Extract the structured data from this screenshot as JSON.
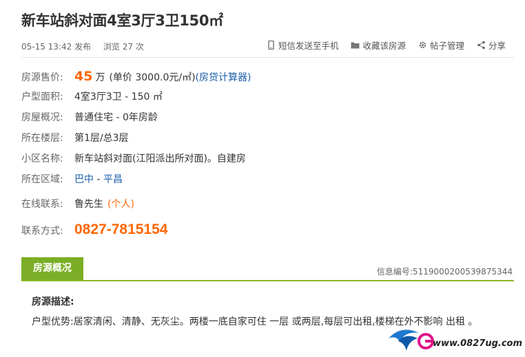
{
  "header": {
    "title": "新车站斜对面4室3厅3卫150㎡",
    "post_time": "05-15 13:42 发布",
    "views": "浏览 27 次"
  },
  "actions": [
    {
      "label": "短信发送至手机",
      "icon": "phone-icon"
    },
    {
      "label": "收藏该房源",
      "icon": "folder-icon"
    },
    {
      "label": "帖子管理",
      "icon": "gear-icon"
    },
    {
      "label": "分享",
      "icon": "share-icon"
    }
  ],
  "details": {
    "price_label": "房源售价:",
    "price_value": "45",
    "price_unit": "万",
    "unit_price": "(单价 3000.0元/㎡)",
    "calculator_link": "(房贷计算器)",
    "layout_label": "户型面积:",
    "layout_value": "4室3厅3卫 - 150 ㎡",
    "overview_label": "房屋概况:",
    "overview_value": "普通住宅 - 0年房龄",
    "floor_label": "所在楼层:",
    "floor_value": "第1层/总3层",
    "community_label": "小区名称:",
    "community_value": "新车站斜对面(江阳派出所对面)。自建房",
    "area_label": "所在区域:",
    "area_city": "巴中",
    "area_separator": " - ",
    "area_district": "平昌",
    "contact_label": "在线联系:",
    "contact_name": "鲁先生",
    "contact_type": "(个人)",
    "phone_label": "联系方式:",
    "phone_value": "0827-7815154"
  },
  "section": {
    "tab_label": "房源概况",
    "info_no": "信息编号:5119000200539875344",
    "desc_title": "房源描述:",
    "desc_text": "户型优势:居家清闲、清静、无灰尘。两楼一底自家可住 一层 或两层,每层可出租,楼梯在外不影响 出租 。"
  },
  "watermark": {
    "url": "www.0827ug.com"
  },
  "colors": {
    "accent_orange": "#ff6600",
    "tab_green": "#7bae26",
    "link_blue": "#1a5fa8"
  }
}
